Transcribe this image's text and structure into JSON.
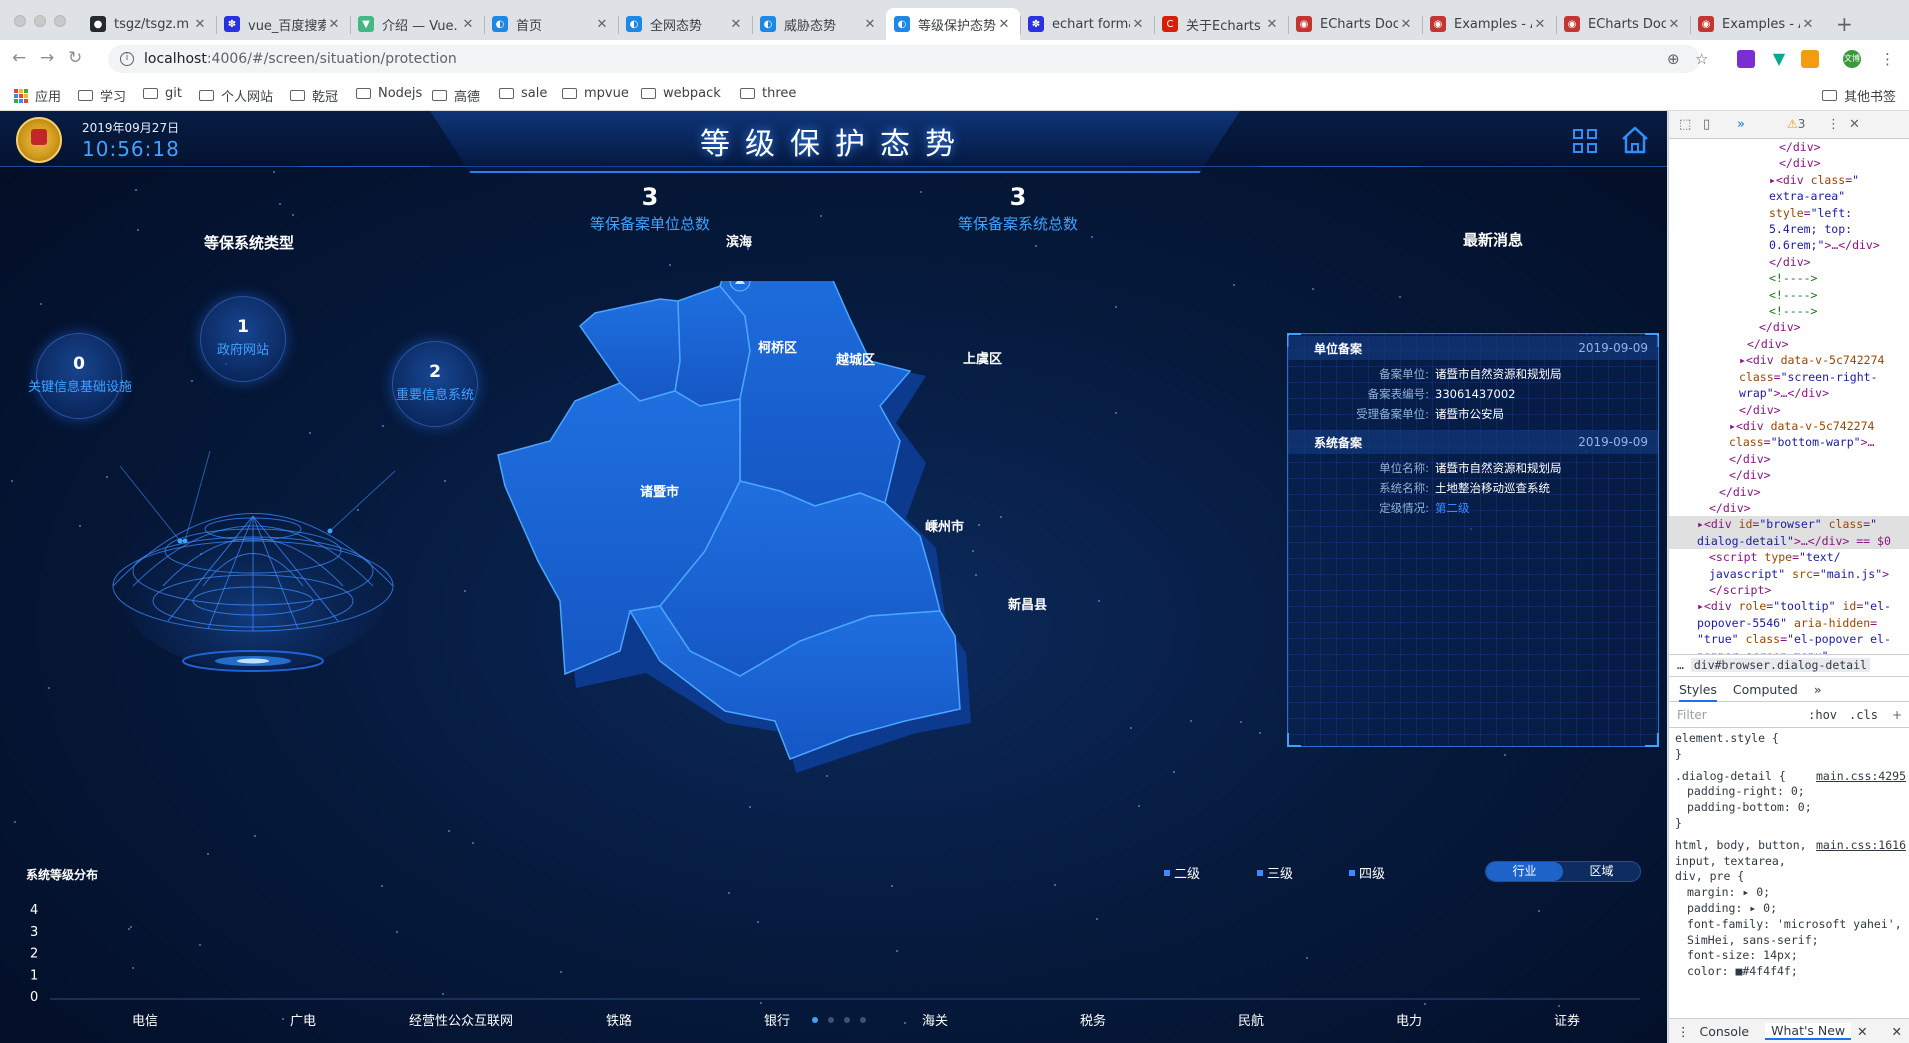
{
  "browser": {
    "tabs": [
      {
        "title": "tsgz/tsgz.m",
        "color": "#24292e",
        "glyph": "●"
      },
      {
        "title": "vue_百度搜索",
        "color": "#2932e1",
        "glyph": "✽"
      },
      {
        "title": "介绍 — Vue.",
        "color": "#42b883",
        "glyph": "▼"
      },
      {
        "title": "首页",
        "color": "#1e88e5",
        "glyph": "◐"
      },
      {
        "title": "全网态势",
        "color": "#1e88e5",
        "glyph": "◐"
      },
      {
        "title": "威胁态势",
        "color": "#1e88e5",
        "glyph": "◐"
      },
      {
        "title": "等级保护态势",
        "color": "#1e88e5",
        "glyph": "◐"
      },
      {
        "title": "echart forma",
        "color": "#2932e1",
        "glyph": "✽"
      },
      {
        "title": "关于Echarts",
        "color": "#d81e06",
        "glyph": "C"
      },
      {
        "title": "ECharts Doc",
        "color": "#c23531",
        "glyph": "◉"
      },
      {
        "title": "Examples - A",
        "color": "#c23531",
        "glyph": "◉"
      },
      {
        "title": "ECharts Doc",
        "color": "#c23531",
        "glyph": "◉"
      },
      {
        "title": "Examples - A",
        "color": "#c23531",
        "glyph": "◉"
      }
    ],
    "active_tab_index": 6,
    "url_host": "localhost",
    "url_rest": ":4006/#/screen/situation/protection",
    "avatar_text": "文博",
    "bookmarks": [
      "应用",
      "学习",
      "git",
      "个人网站",
      "乾冠",
      "Nodejs",
      "高德",
      "sale",
      "mpvue",
      "webpack",
      "three"
    ],
    "other_bookmarks": "其他书签"
  },
  "dashboard": {
    "date": "2019年09月27日",
    "time": "10:56:18",
    "title": "等级保护态势",
    "stats": [
      {
        "value": "3",
        "label": "等保备案单位总数"
      },
      {
        "value": "3",
        "label": "等保备案系统总数"
      }
    ],
    "left_title": "等保系统类型",
    "bubbles": [
      {
        "value": "0",
        "label": "关键信息基础设施"
      },
      {
        "value": "1",
        "label": "政府网站"
      },
      {
        "value": "2",
        "label": "重要信息系统"
      }
    ],
    "map_regions": [
      "滨海",
      "柯桥区",
      "越城区",
      "上虞区",
      "诸暨市",
      "嵊州市",
      "新昌县"
    ],
    "news_title": "最新消息",
    "news": [
      {
        "type": "单位备案",
        "date": "2019-09-09",
        "rows": [
          {
            "k": "备案单位:",
            "v": "诸暨市自然资源和规划局"
          },
          {
            "k": "备案表编号:",
            "v": "33061437002"
          },
          {
            "k": "受理备案单位:",
            "v": "诸暨市公安局"
          }
        ]
      },
      {
        "type": "系统备案",
        "date": "2019-09-09",
        "rows": [
          {
            "k": "单位名称:",
            "v": "诸暨市自然资源和规划局"
          },
          {
            "k": "系统名称:",
            "v": "土地整治移动巡查系统"
          },
          {
            "k": "定级情况:",
            "v": "第二级"
          }
        ]
      }
    ],
    "legend": [
      "二级",
      "三级",
      "四级"
    ],
    "toggle": [
      "行业",
      "区域"
    ],
    "toggle_active": 0,
    "accent": "#3fa2ff"
  },
  "chart_data": {
    "type": "bar",
    "title": "系统等级分布",
    "categories": [
      "电信",
      "广电",
      "经营性公众互联网",
      "铁路",
      "银行",
      "海关",
      "税务",
      "民航",
      "电力",
      "证券"
    ],
    "series": [
      {
        "name": "二级",
        "values": [
          0,
          0,
          0,
          0,
          0,
          0,
          0,
          0,
          0,
          0
        ]
      },
      {
        "name": "三级",
        "values": [
          0,
          0,
          0,
          0,
          0,
          0,
          0,
          0,
          0,
          0
        ]
      },
      {
        "name": "四级",
        "values": [
          0,
          0,
          0,
          0,
          0,
          0,
          0,
          0,
          0,
          0
        ]
      }
    ],
    "yticks": [
      "0",
      "1",
      "2",
      "3",
      "4"
    ],
    "ylim": [
      0,
      4
    ],
    "pages": 4,
    "current_page": 0
  },
  "devtools": {
    "warnings": "3",
    "tree": [
      {
        "indent": 110,
        "html": "<span class='tag'>&lt;/div&gt;</span>"
      },
      {
        "indent": 110,
        "html": "<span class='tag'>&lt;/div&gt;</span>"
      },
      {
        "indent": 100,
        "html": "▸<span class='tag'>&lt;div </span><span class='an'>class</span>=<span class='av'>\"</span>"
      },
      {
        "indent": 100,
        "html": "<span class='av'>extra-area\"</span>"
      },
      {
        "indent": 100,
        "html": "<span class='an'>style</span>=<span class='av'>\"left:</span>"
      },
      {
        "indent": 100,
        "html": "<span class='av'>5.4rem; top:</span>"
      },
      {
        "indent": 100,
        "html": "<span class='av'>0.6rem;\"</span><span class='tag'>&gt;…&lt;/div&gt;</span>"
      },
      {
        "indent": 100,
        "html": "<span class='tag'>&lt;/div&gt;</span>"
      },
      {
        "indent": 100,
        "html": "<span class='cm'>&lt;!----&gt;</span>"
      },
      {
        "indent": 100,
        "html": "<span class='cm'>&lt;!----&gt;</span>"
      },
      {
        "indent": 100,
        "html": "<span class='cm'>&lt;!----&gt;</span>"
      },
      {
        "indent": 90,
        "html": "<span class='tag'>&lt;/div&gt;</span>"
      },
      {
        "indent": 78,
        "html": "<span class='tag'>&lt;/div&gt;</span>"
      },
      {
        "indent": 70,
        "html": "▸<span class='tag'>&lt;div </span><span class='an'>data-v-5c742274</span>"
      },
      {
        "indent": 70,
        "html": "<span class='an'>class</span>=<span class='av'>\"screen-right-</span>"
      },
      {
        "indent": 70,
        "html": "<span class='av'>wrap\"</span><span class='tag'>&gt;…&lt;/div&gt;</span>"
      },
      {
        "indent": 70,
        "html": "<span class='tag'>&lt;/div&gt;</span>"
      },
      {
        "indent": 60,
        "html": "▸<span class='tag'>&lt;div </span><span class='an'>data-v-5c742274</span>"
      },
      {
        "indent": 60,
        "html": "<span class='an'>class</span>=<span class='av'>\"bottom-warp\"</span><span class='tag'>&gt;…</span>"
      },
      {
        "indent": 60,
        "html": "<span class='tag'>&lt;/div&gt;</span>"
      },
      {
        "indent": 60,
        "html": "<span class='tag'>&lt;/div&gt;</span>"
      },
      {
        "indent": 50,
        "html": "<span class='tag'>&lt;/div&gt;</span>"
      },
      {
        "indent": 40,
        "html": "<span class='tag'>&lt;/div&gt;</span>"
      },
      {
        "indent": 28,
        "sel": true,
        "html": "▸<span class='tag'>&lt;div </span><span class='an'>id</span>=<span class='av'>\"browser\"</span> <span class='an'>class</span>=<span class='av'>\"</span>"
      },
      {
        "indent": 28,
        "sel": true,
        "html": "<span class='av'>dialog-detail\"</span><span class='tag'>&gt;…&lt;/div&gt;</span> == $0"
      },
      {
        "indent": 40,
        "html": "<span class='tag'>&lt;script </span><span class='an'>type</span>=<span class='av'>\"text/</span>"
      },
      {
        "indent": 40,
        "html": "<span class='av'>javascript\"</span> <span class='an'>src</span>=<span class='av'>\"main.js\"</span><span class='tag'>&gt;</span>"
      },
      {
        "indent": 40,
        "html": "<span class='tag'>&lt;/script&gt;</span>"
      },
      {
        "indent": 28,
        "html": "▸<span class='tag'>&lt;div </span><span class='an'>role</span>=<span class='av'>\"tooltip\"</span> <span class='an'>id</span>=<span class='av'>\"el-</span>"
      },
      {
        "indent": 28,
        "html": "<span class='av'>popover-5546\"</span> <span class='an'>aria-hidden</span>="
      },
      {
        "indent": 28,
        "html": "<span class='av'>\"true\"</span> <span class='an'>class</span>=<span class='av'>\"el-popover el-</span>"
      },
      {
        "indent": 28,
        "html": "<span class='av'>popper screen-menu\"</span>"
      }
    ],
    "breadcrumb": "div#browser.dialog-detail",
    "tabs": [
      "Styles",
      "Computed"
    ],
    "filter_placeholder": "Filter",
    "hov": ":hov",
    "cls": ".cls",
    "styles": {
      "element_style": "element.style {",
      "close": "}",
      "rule1_selector": ".dialog-detail {",
      "rule1_source": "main.css:4295",
      "rule1_props": [
        "padding-right: 0;",
        "padding-bottom: 0;"
      ],
      "rule2_selector": "html, body, button, input, textarea, div, pre {",
      "rule2_source": "main.css:1616",
      "rule2_props": [
        "margin: ▸ 0;",
        "padding: ▸ 0;",
        "font-family: 'microsoft yahei', SimHei, sans-serif;",
        "font-size: 14px;",
        "color: ■#4f4f4f;"
      ]
    },
    "drawer": [
      "Console",
      "What's New"
    ]
  }
}
